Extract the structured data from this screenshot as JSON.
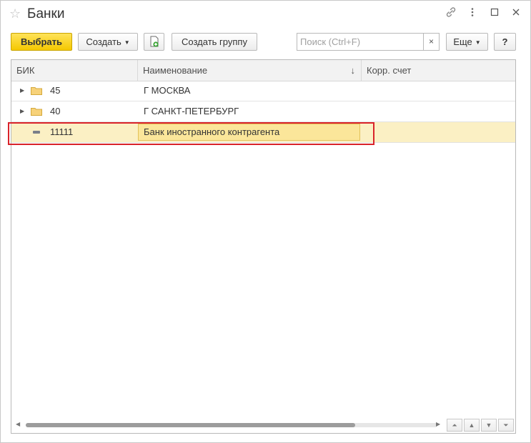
{
  "window": {
    "title": "Банки",
    "icons": [
      "star-icon",
      "link-icon",
      "more-icon",
      "maximize-icon",
      "close-icon"
    ]
  },
  "toolbar": {
    "select_label": "Выбрать",
    "create_label": "Создать",
    "create_group_label": "Создать группу",
    "more_label": "Еще",
    "help_label": "?",
    "search_placeholder": "Поиск (Ctrl+F)",
    "search_clear": "×"
  },
  "table": {
    "columns": [
      "БИК",
      "Наименование",
      "Корр. счет"
    ],
    "sort_indicator": "↓",
    "rows": [
      {
        "bik": "45",
        "name": "Г МОСКВА",
        "corr": "",
        "type": "folder"
      },
      {
        "bik": "40",
        "name": "Г САНКТ-ПЕТЕРБУРГ",
        "corr": "",
        "type": "folder"
      },
      {
        "bik": "11111",
        "name": "Банк иностранного контрагента",
        "corr": "",
        "type": "item"
      }
    ]
  },
  "colors": {
    "accent": "#f5c800",
    "selected_row": "#fbf0c4",
    "highlight_border": "#d9232a"
  }
}
